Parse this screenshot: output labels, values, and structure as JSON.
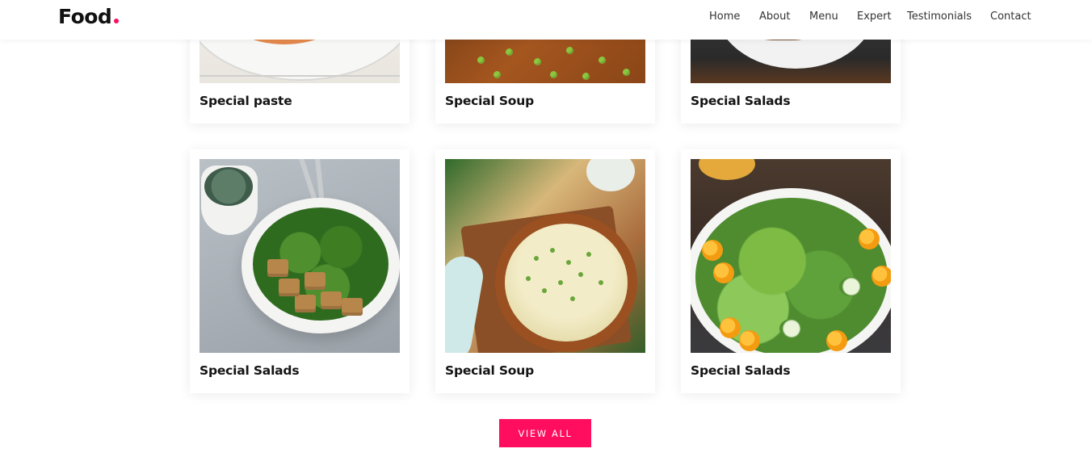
{
  "brand": {
    "name": "Food",
    "dot": "."
  },
  "nav": {
    "items": [
      "Home",
      "About",
      "Menu",
      "Expert",
      "Testimonials",
      "Contact"
    ]
  },
  "menu": {
    "items": [
      {
        "title": "Special paste",
        "image": "pasta"
      },
      {
        "title": "Special Soup",
        "image": "peas soup"
      },
      {
        "title": "Special Salads",
        "image": "meat salad"
      },
      {
        "title": "Special Salads",
        "image": "tofu bowl"
      },
      {
        "title": "Special Soup",
        "image": "miso soup"
      },
      {
        "title": "Special Salads",
        "image": "vegetable salad"
      }
    ]
  },
  "cta": {
    "label": "VIEW ALL"
  },
  "colors": {
    "accent": "#ff0d5f",
    "text": "#111111",
    "nav_text": "#333333"
  }
}
